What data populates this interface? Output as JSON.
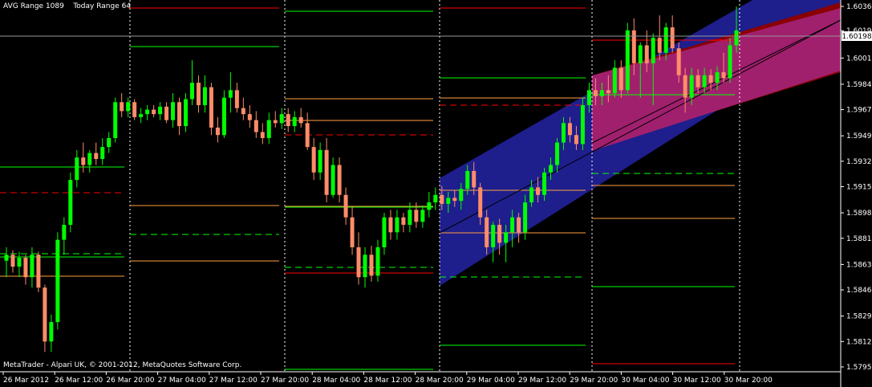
{
  "indicator": {
    "avg_label": "AVG Range 1089",
    "today_label": "Today Range 64"
  },
  "footer": {
    "copyright": "MetaTrader - Alpari UK, © 2001-2012, MetaQuotes Software Corp."
  },
  "current_price": "1.60198",
  "colors": {
    "background": "#000000",
    "bull": "#00ff00",
    "bear": "#ff8c69",
    "channel_blue": "#1e1e8c",
    "channel_magenta": "#a0206e",
    "channel_red": "#8b0000",
    "level_green": "#00ff00",
    "level_red": "#ff0000",
    "level_orange": "#ffa040",
    "separator": "#ffffff"
  },
  "chart_data": {
    "type": "candlestick",
    "symbol_period": "",
    "price_axis_ticks": [
      "1.60360",
      "1.60198",
      "1.60015",
      "1.59840",
      "1.59670",
      "1.59495",
      "1.59325",
      "1.59155",
      "1.58980",
      "1.58810",
      "1.58635",
      "1.58465",
      "1.58290",
      "1.58120",
      "1.57950"
    ],
    "time_axis_ticks": [
      "26 Mar 2012",
      "26 Mar 12:00",
      "26 Mar 20:00",
      "27 Mar 04:00",
      "27 Mar 12:00",
      "27 Mar 20:00",
      "28 Mar 04:00",
      "28 Mar 12:00",
      "28 Mar 20:00",
      "29 Mar 04:00",
      "29 Mar 12:00",
      "29 Mar 20:00",
      "30 Mar 04:00",
      "30 Mar 12:00",
      "30 Mar 20:00"
    ],
    "ylim": [
      1.5795,
      1.6036
    ],
    "candles": [
      {
        "o": 1.5866,
        "h": 1.5875,
        "l": 1.5855,
        "c": 1.587
      },
      {
        "o": 1.587,
        "h": 1.5873,
        "l": 1.5858,
        "c": 1.5862
      },
      {
        "o": 1.5862,
        "h": 1.5872,
        "l": 1.5855,
        "c": 1.5868
      },
      {
        "o": 1.5868,
        "h": 1.587,
        "l": 1.585,
        "c": 1.5855
      },
      {
        "o": 1.5855,
        "h": 1.5875,
        "l": 1.5848,
        "c": 1.587
      },
      {
        "o": 1.587,
        "h": 1.5872,
        "l": 1.5845,
        "c": 1.5848
      },
      {
        "o": 1.5848,
        "h": 1.585,
        "l": 1.5805,
        "c": 1.5812
      },
      {
        "o": 1.5812,
        "h": 1.583,
        "l": 1.5805,
        "c": 1.5825
      },
      {
        "o": 1.5825,
        "h": 1.5885,
        "l": 1.582,
        "c": 1.588
      },
      {
        "o": 1.588,
        "h": 1.5895,
        "l": 1.587,
        "c": 1.589
      },
      {
        "o": 1.589,
        "h": 1.5925,
        "l": 1.5885,
        "c": 1.592
      },
      {
        "o": 1.592,
        "h": 1.594,
        "l": 1.5915,
        "c": 1.5935
      },
      {
        "o": 1.5935,
        "h": 1.5945,
        "l": 1.5925,
        "c": 1.593
      },
      {
        "o": 1.593,
        "h": 1.594,
        "l": 1.5925,
        "c": 1.5938
      },
      {
        "o": 1.5938,
        "h": 1.5945,
        "l": 1.593,
        "c": 1.5934
      },
      {
        "o": 1.5934,
        "h": 1.5948,
        "l": 1.593,
        "c": 1.5942
      },
      {
        "o": 1.5942,
        "h": 1.5952,
        "l": 1.5938,
        "c": 1.5948
      },
      {
        "o": 1.5948,
        "h": 1.5975,
        "l": 1.5945,
        "c": 1.5972
      },
      {
        "o": 1.5972,
        "h": 1.5978,
        "l": 1.5962,
        "c": 1.5966
      },
      {
        "o": 1.5966,
        "h": 1.5975,
        "l": 1.5962,
        "c": 1.5972
      },
      {
        "o": 1.5972,
        "h": 1.5974,
        "l": 1.596,
        "c": 1.5962
      },
      {
        "o": 1.5962,
        "h": 1.5968,
        "l": 1.5958,
        "c": 1.5964
      },
      {
        "o": 1.5964,
        "h": 1.597,
        "l": 1.596,
        "c": 1.5967
      },
      {
        "o": 1.5967,
        "h": 1.597,
        "l": 1.5962,
        "c": 1.5964
      },
      {
        "o": 1.5964,
        "h": 1.5972,
        "l": 1.596,
        "c": 1.5969
      },
      {
        "o": 1.5969,
        "h": 1.5972,
        "l": 1.5958,
        "c": 1.596
      },
      {
        "o": 1.596,
        "h": 1.5978,
        "l": 1.5955,
        "c": 1.5972
      },
      {
        "o": 1.5972,
        "h": 1.5975,
        "l": 1.595,
        "c": 1.5956
      },
      {
        "o": 1.5956,
        "h": 1.5978,
        "l": 1.5952,
        "c": 1.5974
      },
      {
        "o": 1.5974,
        "h": 1.6,
        "l": 1.597,
        "c": 1.5985
      },
      {
        "o": 1.5985,
        "h": 1.599,
        "l": 1.5965,
        "c": 1.597
      },
      {
        "o": 1.597,
        "h": 1.599,
        "l": 1.5965,
        "c": 1.5982
      },
      {
        "o": 1.5982,
        "h": 1.5985,
        "l": 1.595,
        "c": 1.5955
      },
      {
        "o": 1.5955,
        "h": 1.5962,
        "l": 1.5945,
        "c": 1.595
      },
      {
        "o": 1.595,
        "h": 1.598,
        "l": 1.5948,
        "c": 1.5975
      },
      {
        "o": 1.5975,
        "h": 1.5992,
        "l": 1.5965,
        "c": 1.598
      },
      {
        "o": 1.598,
        "h": 1.5985,
        "l": 1.5965,
        "c": 1.5968
      },
      {
        "o": 1.5968,
        "h": 1.5975,
        "l": 1.596,
        "c": 1.5964
      },
      {
        "o": 1.5964,
        "h": 1.597,
        "l": 1.5955,
        "c": 1.596
      },
      {
        "o": 1.596,
        "h": 1.5966,
        "l": 1.5948,
        "c": 1.5952
      },
      {
        "o": 1.5952,
        "h": 1.5958,
        "l": 1.5944,
        "c": 1.5948
      },
      {
        "o": 1.5948,
        "h": 1.5965,
        "l": 1.5944,
        "c": 1.596
      },
      {
        "o": 1.596,
        "h": 1.5966,
        "l": 1.5955,
        "c": 1.5958
      },
      {
        "o": 1.5958,
        "h": 1.5968,
        "l": 1.5954,
        "c": 1.5964
      },
      {
        "o": 1.5964,
        "h": 1.5968,
        "l": 1.5952,
        "c": 1.5956
      },
      {
        "o": 1.5956,
        "h": 1.5966,
        "l": 1.5952,
        "c": 1.5962
      },
      {
        "o": 1.5962,
        "h": 1.5968,
        "l": 1.5955,
        "c": 1.5958
      },
      {
        "o": 1.5958,
        "h": 1.5965,
        "l": 1.594,
        "c": 1.5942
      },
      {
        "o": 1.5942,
        "h": 1.5948,
        "l": 1.592,
        "c": 1.5925
      },
      {
        "o": 1.5925,
        "h": 1.5945,
        "l": 1.592,
        "c": 1.594
      },
      {
        "o": 1.594,
        "h": 1.5948,
        "l": 1.5905,
        "c": 1.591
      },
      {
        "o": 1.591,
        "h": 1.5935,
        "l": 1.5908,
        "c": 1.593
      },
      {
        "o": 1.593,
        "h": 1.5935,
        "l": 1.5905,
        "c": 1.591
      },
      {
        "o": 1.591,
        "h": 1.5915,
        "l": 1.589,
        "c": 1.5895
      },
      {
        "o": 1.5895,
        "h": 1.5902,
        "l": 1.587,
        "c": 1.5875
      },
      {
        "o": 1.5875,
        "h": 1.5885,
        "l": 1.585,
        "c": 1.5855
      },
      {
        "o": 1.5855,
        "h": 1.5875,
        "l": 1.5848,
        "c": 1.587
      },
      {
        "o": 1.587,
        "h": 1.5876,
        "l": 1.5852,
        "c": 1.5856
      },
      {
        "o": 1.5856,
        "h": 1.588,
        "l": 1.5852,
        "c": 1.5875
      },
      {
        "o": 1.5875,
        "h": 1.5898,
        "l": 1.587,
        "c": 1.5895
      },
      {
        "o": 1.5895,
        "h": 1.59,
        "l": 1.588,
        "c": 1.5885
      },
      {
        "o": 1.5885,
        "h": 1.59,
        "l": 1.588,
        "c": 1.5895
      },
      {
        "o": 1.5895,
        "h": 1.5898,
        "l": 1.5885,
        "c": 1.589
      },
      {
        "o": 1.589,
        "h": 1.5905,
        "l": 1.5885,
        "c": 1.59
      },
      {
        "o": 1.59,
        "h": 1.5905,
        "l": 1.5888,
        "c": 1.5892
      },
      {
        "o": 1.5892,
        "h": 1.5903,
        "l": 1.5888,
        "c": 1.59
      },
      {
        "o": 1.59,
        "h": 1.5912,
        "l": 1.5895,
        "c": 1.5905
      },
      {
        "o": 1.5905,
        "h": 1.5915,
        "l": 1.59,
        "c": 1.591
      },
      {
        "o": 1.591,
        "h": 1.5916,
        "l": 1.59,
        "c": 1.5904
      },
      {
        "o": 1.5904,
        "h": 1.5912,
        "l": 1.5898,
        "c": 1.5908
      },
      {
        "o": 1.5908,
        "h": 1.5913,
        "l": 1.5902,
        "c": 1.5906
      },
      {
        "o": 1.5906,
        "h": 1.5918,
        "l": 1.59,
        "c": 1.5914
      },
      {
        "o": 1.5914,
        "h": 1.593,
        "l": 1.591,
        "c": 1.5926
      },
      {
        "o": 1.5926,
        "h": 1.5932,
        "l": 1.591,
        "c": 1.5915
      },
      {
        "o": 1.5915,
        "h": 1.5918,
        "l": 1.589,
        "c": 1.5895
      },
      {
        "o": 1.5895,
        "h": 1.59,
        "l": 1.587,
        "c": 1.5875
      },
      {
        "o": 1.5875,
        "h": 1.5892,
        "l": 1.5865,
        "c": 1.589
      },
      {
        "o": 1.589,
        "h": 1.5894,
        "l": 1.587,
        "c": 1.5878
      },
      {
        "o": 1.5878,
        "h": 1.589,
        "l": 1.5865,
        "c": 1.5885
      },
      {
        "o": 1.5885,
        "h": 1.59,
        "l": 1.5875,
        "c": 1.5895
      },
      {
        "o": 1.5895,
        "h": 1.5898,
        "l": 1.5878,
        "c": 1.5885
      },
      {
        "o": 1.5885,
        "h": 1.591,
        "l": 1.588,
        "c": 1.5905
      },
      {
        "o": 1.5905,
        "h": 1.592,
        "l": 1.5902,
        "c": 1.5915
      },
      {
        "o": 1.5915,
        "h": 1.5922,
        "l": 1.5905,
        "c": 1.591
      },
      {
        "o": 1.591,
        "h": 1.5928,
        "l": 1.5906,
        "c": 1.5925
      },
      {
        "o": 1.5925,
        "h": 1.5935,
        "l": 1.592,
        "c": 1.593
      },
      {
        "o": 1.593,
        "h": 1.5948,
        "l": 1.5925,
        "c": 1.5945
      },
      {
        "o": 1.5945,
        "h": 1.5962,
        "l": 1.594,
        "c": 1.5958
      },
      {
        "o": 1.5958,
        "h": 1.5962,
        "l": 1.5945,
        "c": 1.595
      },
      {
        "o": 1.595,
        "h": 1.5956,
        "l": 1.594,
        "c": 1.5944
      },
      {
        "o": 1.5944,
        "h": 1.5975,
        "l": 1.594,
        "c": 1.597
      },
      {
        "o": 1.597,
        "h": 1.5985,
        "l": 1.5965,
        "c": 1.598
      },
      {
        "o": 1.598,
        "h": 1.5988,
        "l": 1.597,
        "c": 1.5976
      },
      {
        "o": 1.5976,
        "h": 1.5985,
        "l": 1.597,
        "c": 1.598
      },
      {
        "o": 1.598,
        "h": 1.599,
        "l": 1.5972,
        "c": 1.5978
      },
      {
        "o": 1.5978,
        "h": 1.6,
        "l": 1.5975,
        "c": 1.5995
      },
      {
        "o": 1.5995,
        "h": 1.6,
        "l": 1.5975,
        "c": 1.598
      },
      {
        "o": 1.598,
        "h": 1.6025,
        "l": 1.5978,
        "c": 1.602
      },
      {
        "o": 1.602,
        "h": 1.6028,
        "l": 1.599,
        "c": 1.5998
      },
      {
        "o": 1.5998,
        "h": 1.6012,
        "l": 1.5975,
        "c": 1.601
      },
      {
        "o": 1.601,
        "h": 1.602,
        "l": 1.5992,
        "c": 1.5998
      },
      {
        "o": 1.5998,
        "h": 1.6018,
        "l": 1.597,
        "c": 1.6015
      },
      {
        "o": 1.6015,
        "h": 1.603,
        "l": 1.6,
        "c": 1.6005
      },
      {
        "o": 1.6005,
        "h": 1.6025,
        "l": 1.6,
        "c": 1.6022
      },
      {
        "o": 1.6022,
        "h": 1.603,
        "l": 1.6005,
        "c": 1.6008
      },
      {
        "o": 1.6008,
        "h": 1.6012,
        "l": 1.5985,
        "c": 1.599
      },
      {
        "o": 1.599,
        "h": 1.5995,
        "l": 1.5965,
        "c": 1.5975
      },
      {
        "o": 1.5975,
        "h": 1.5995,
        "l": 1.597,
        "c": 1.599
      },
      {
        "o": 1.599,
        "h": 1.5994,
        "l": 1.5978,
        "c": 1.5982
      },
      {
        "o": 1.5982,
        "h": 1.5995,
        "l": 1.5978,
        "c": 1.599
      },
      {
        "o": 1.599,
        "h": 1.5994,
        "l": 1.598,
        "c": 1.5985
      },
      {
        "o": 1.5985,
        "h": 1.5996,
        "l": 1.598,
        "c": 1.5992
      },
      {
        "o": 1.5992,
        "h": 1.6005,
        "l": 1.5985,
        "c": 1.5988
      },
      {
        "o": 1.5988,
        "h": 1.6015,
        "l": 1.5985,
        "c": 1.601
      },
      {
        "o": 1.601,
        "h": 1.6036,
        "l": 1.6005,
        "c": 1.602
      }
    ]
  }
}
